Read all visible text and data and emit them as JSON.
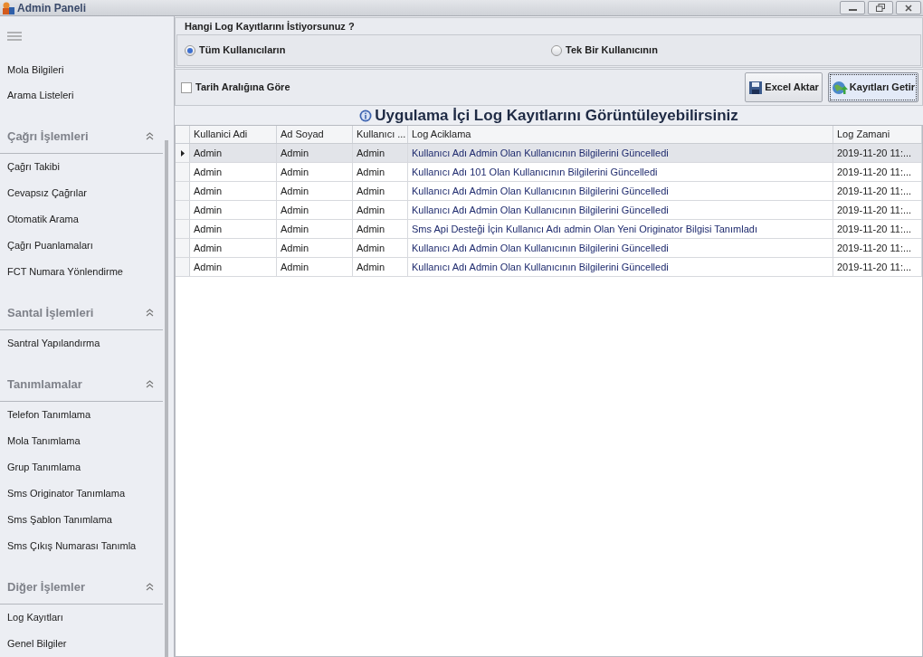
{
  "window": {
    "title": "Admin Paneli"
  },
  "sidebar": {
    "top_items": [
      "Mola Bilgileri",
      "Arama Listeleri"
    ],
    "groups": [
      {
        "title": "Çağrı İşlemleri",
        "expanded": true,
        "items": [
          "Çağrı Takibi",
          "Cevapsız Çağrılar",
          "Otomatik Arama",
          "Çağrı Puanlamaları",
          "FCT Numara Yönlendirme"
        ]
      },
      {
        "title": "Santal İşlemleri",
        "expanded": true,
        "items": [
          "Santral Yapılandırma"
        ]
      },
      {
        "title": "Tanımlamalar",
        "expanded": true,
        "items": [
          "Telefon Tanımlama",
          "Mola Tanımlama",
          "Grup Tanımlama",
          "Sms Originator Tanımlama",
          "Sms Şablon Tanımlama",
          "Sms Çıkış Numarası Tanımla"
        ]
      },
      {
        "title": "Diğer İşlemler",
        "expanded": true,
        "items": [
          "Log Kayıtları",
          "Genel Bilgiler"
        ]
      }
    ]
  },
  "filter": {
    "heading": "Hangi Log Kayıtlarını İstiyorsunuz ?",
    "radios": [
      {
        "label": "Tüm Kullanıcıların",
        "selected": true
      },
      {
        "label": "Tek Bir Kullanıcının",
        "selected": false
      }
    ],
    "date_range": {
      "label": "Tarih Aralığına Göre",
      "checked": false
    },
    "buttons": [
      {
        "label": "Excel Aktar",
        "kind": "export",
        "focused": false
      },
      {
        "label": "Kayıtları Getir",
        "kind": "fetch",
        "focused": true
      }
    ]
  },
  "banner": "Uygulama İçi Log Kayıtlarını Görüntüleyebilirsiniz",
  "table": {
    "columns": [
      "Kullanici Adi",
      "Ad Soyad",
      "Kullanıcı ...",
      "Log Aciklama",
      "Log Zamani"
    ],
    "rows": [
      {
        "selected": true,
        "cells": [
          "Admin",
          "Admin",
          "Admin",
          "Kullanıcı Adı Admin Olan Kullanıcının Bilgilerini Güncelledi",
          "2019-11-20 11:..."
        ]
      },
      {
        "selected": false,
        "cells": [
          "Admin",
          "Admin",
          "Admin",
          "Kullanıcı Adı 101 Olan Kullanıcının Bilgilerini Güncelledi",
          "2019-11-20 11:..."
        ]
      },
      {
        "selected": false,
        "cells": [
          "Admin",
          "Admin",
          "Admin",
          "Kullanıcı Adı Admin Olan Kullanıcının Bilgilerini Güncelledi",
          "2019-11-20 11:..."
        ]
      },
      {
        "selected": false,
        "cells": [
          "Admin",
          "Admin",
          "Admin",
          "Kullanıcı Adı Admin Olan Kullanıcının Bilgilerini Güncelledi",
          "2019-11-20 11:..."
        ]
      },
      {
        "selected": false,
        "cells": [
          "Admin",
          "Admin",
          "Admin",
          "Sms Api Desteği İçin Kullanıcı Adı admin Olan Yeni Originator Bilgisi Tanımladı",
          "2019-11-20 11:..."
        ]
      },
      {
        "selected": false,
        "cells": [
          "Admin",
          "Admin",
          "Admin",
          "Kullanıcı Adı Admin Olan Kullanıcının Bilgilerini Güncelledi",
          "2019-11-20 11:..."
        ]
      },
      {
        "selected": false,
        "cells": [
          "Admin",
          "Admin",
          "Admin",
          "Kullanıcı Adı Admin Olan Kullanıcının Bilgilerini Güncelledi",
          "2019-11-20 11:..."
        ]
      }
    ]
  }
}
